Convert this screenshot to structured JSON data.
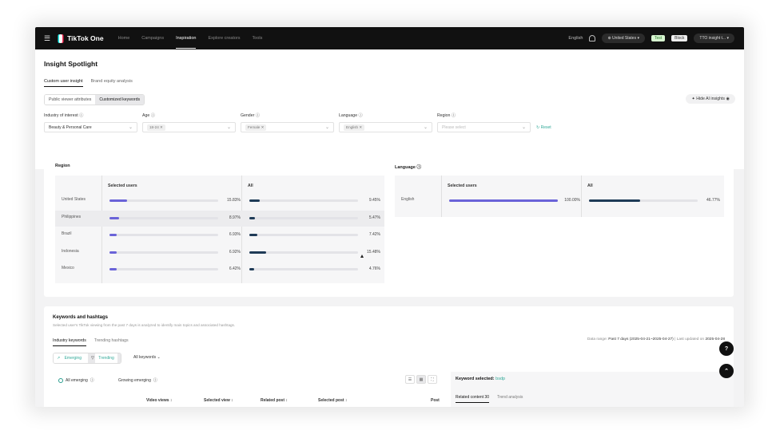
{
  "topbar": {
    "brand": "TikTok One",
    "nav": [
      "Home",
      "Campaigns",
      "Inspiration",
      "Explore creators",
      "Tools"
    ],
    "language": "English",
    "region_pill": "United States",
    "badge1": "Test",
    "badge2": "Block",
    "account": "TTO insight t..."
  },
  "page": {
    "title": "Insight Spotlight",
    "tabs": [
      "Custom user insight",
      "Brand equity analysis"
    ],
    "segments": [
      "Public viewer attributes",
      "Customized keywords"
    ],
    "hide_ai": "Hide AI insights"
  },
  "filters": {
    "industry_label": "Industry of interest",
    "industry_value": "Beauty & Personal Care",
    "age_label": "Age",
    "age_tag": "18-24",
    "gender_label": "Gender",
    "gender_tag": "Female",
    "language_label": "Language",
    "language_tag": "English",
    "region_label": "Region",
    "region_placeholder": "Please select",
    "reset": "Reset"
  },
  "region": {
    "title": "Region",
    "col_selected": "Selected users",
    "col_all": "All",
    "rows": [
      {
        "name": "United States",
        "sel": "15.83%",
        "all": "9.45%",
        "sel_v": 15.83,
        "all_v": 9.45
      },
      {
        "name": "Philippines",
        "sel": "8.97%",
        "all": "5.47%",
        "sel_v": 8.97,
        "all_v": 5.47
      },
      {
        "name": "Brazil",
        "sel": "6.93%",
        "all": "7.42%",
        "sel_v": 6.93,
        "all_v": 7.42
      },
      {
        "name": "Indonesia",
        "sel": "6.92%",
        "all": "15.48%",
        "sel_v": 6.92,
        "all_v": 15.48
      },
      {
        "name": "Mexico",
        "sel": "6.42%",
        "all": "4.76%",
        "sel_v": 6.42,
        "all_v": 4.76
      }
    ]
  },
  "language": {
    "title": "Language",
    "col_selected": "Selected users",
    "col_all": "All",
    "rows": [
      {
        "name": "English",
        "sel": "100.00%",
        "all": "46.77%",
        "sel_v": 100,
        "all_v": 46.77
      }
    ]
  },
  "keywords": {
    "title": "Keywords and hashtags",
    "subtitle": "Selected user's TikTok viewing from the past 7 days is analyzed to identify main topics and associated hashtags.",
    "tabs": [
      "Industry keywords",
      "Trending hashtags"
    ],
    "date_label": "Data range:",
    "date_value": "Past 7 days (2025-04-21~2025-04-27)",
    "updated_label": "| Last updated on",
    "updated_value": "2025-04-28",
    "segments": [
      "Emerging",
      "Trending"
    ],
    "all_keywords": "All keywords",
    "radio1": "All emerging",
    "radio2": "Growing emerging",
    "columns": [
      "Video views",
      "Selected view",
      "Related post",
      "Selected post",
      "Post"
    ],
    "selected_label": "Keyword selected:",
    "selected_value": "bsdp",
    "side_tabs": [
      "Related content 30",
      "Trend analysis"
    ]
  },
  "colors": {
    "selected_bar": "#6a63d8",
    "all_bar": "#1f3b57",
    "accent": "#2a9d8f"
  }
}
